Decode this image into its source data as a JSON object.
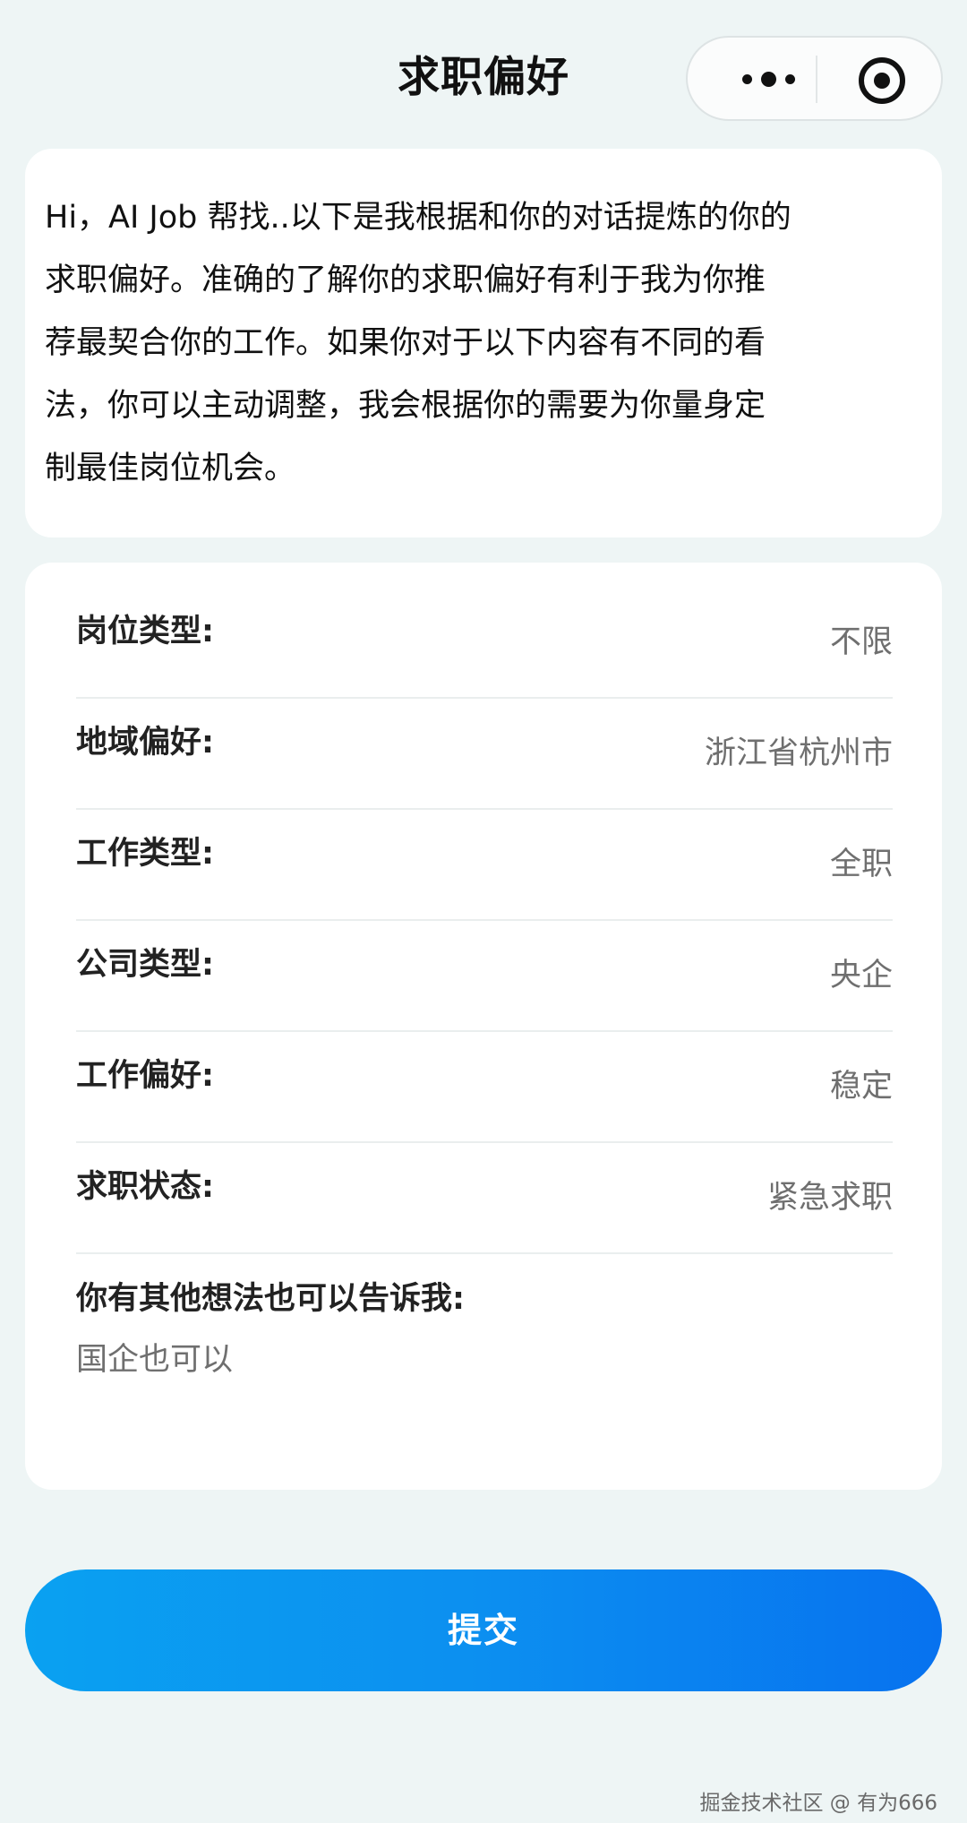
{
  "header": {
    "title": "求职偏好",
    "more_icon": "more-dots-icon",
    "close_icon": "target-close-icon"
  },
  "intro": {
    "lines": [
      "Hi，AI Job 帮找..以下是我根据和你的对话提炼的你的",
      "求职偏好。准确的了解你的求职偏好有利于我为你推",
      "荐最契合你的工作。如果你对于以下内容有不同的看",
      "法，你可以主动调整，我会根据你的需要为你量身定",
      "制最佳岗位机会。"
    ]
  },
  "preferences": {
    "rows": [
      {
        "label": "岗位类型:",
        "value": "不限"
      },
      {
        "label": "地域偏好:",
        "value": "浙江省杭州市"
      },
      {
        "label": "工作类型:",
        "value": "全职"
      },
      {
        "label": "公司类型:",
        "value": "央企"
      },
      {
        "label": "工作偏好:",
        "value": "稳定"
      },
      {
        "label": "求职状态:",
        "value": "紧急求职"
      }
    ],
    "other_label": "你有其他想法也可以告诉我:",
    "other_value": "国企也可以"
  },
  "submit": {
    "label": "提交"
  },
  "watermark": {
    "text": "掘金技术社区 @ 有为666"
  },
  "colors": {
    "background": "#eef5f5",
    "button_gradient_start": "#0aa1f1",
    "button_gradient_end": "#0772ef",
    "value_text": "#6f6f6f"
  }
}
